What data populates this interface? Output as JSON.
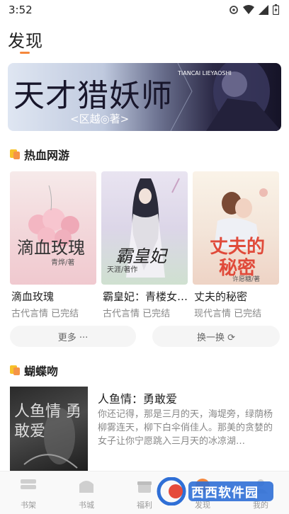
{
  "status_bar": {
    "time": "3:52"
  },
  "page": {
    "title": "发现"
  },
  "banner": {
    "title": "天才猎妖师",
    "author": "<区越◎著>",
    "sub": "TIANCAI LIEYAOSHI"
  },
  "sections": [
    {
      "title": "热血网游",
      "books": [
        {
          "title": "滴血玫瑰",
          "category": "古代言情",
          "status": "已完结",
          "cover_text": "滴血玫瑰",
          "cover_author": "青烨/著"
        },
        {
          "title": "霸皇妃：青楼女…",
          "category": "古代言情",
          "status": "已完结",
          "cover_text": "霸皇妃",
          "cover_author": "天涯/著作"
        },
        {
          "title": "丈夫的秘密",
          "category": "现代言情",
          "status": "已完结",
          "cover_text": "丈夫的秘密",
          "cover_author": "许愿糖/著"
        }
      ],
      "more_label": "更多 ···",
      "refresh_label": "换一换 ⟳"
    },
    {
      "title": "蝴蝶吻",
      "book": {
        "title": "人鱼情：勇敢爱",
        "description": "你还记得，那是三月的天，海堤旁，绿荫杨柳雾连天，柳下白伞俏佳人。那美的贪婪的女子让你宁愿跳入三月天的冰凉湖…",
        "cover_text": "人鱼情 勇敢爱"
      }
    }
  ],
  "bottom_nav": [
    {
      "label": "书架",
      "icon": "bookshelf-icon"
    },
    {
      "label": "书城",
      "icon": "store-icon"
    },
    {
      "label": "福利",
      "icon": "gift-icon"
    },
    {
      "label": "发现",
      "icon": "discover-icon"
    },
    {
      "label": "我的",
      "icon": "profile-icon"
    }
  ],
  "watermark": {
    "text": "西西软件园"
  },
  "colors": {
    "accent": "#f5883c",
    "section_icon_yellow": "#f7c12a",
    "section_icon_orange": "#f59447"
  }
}
